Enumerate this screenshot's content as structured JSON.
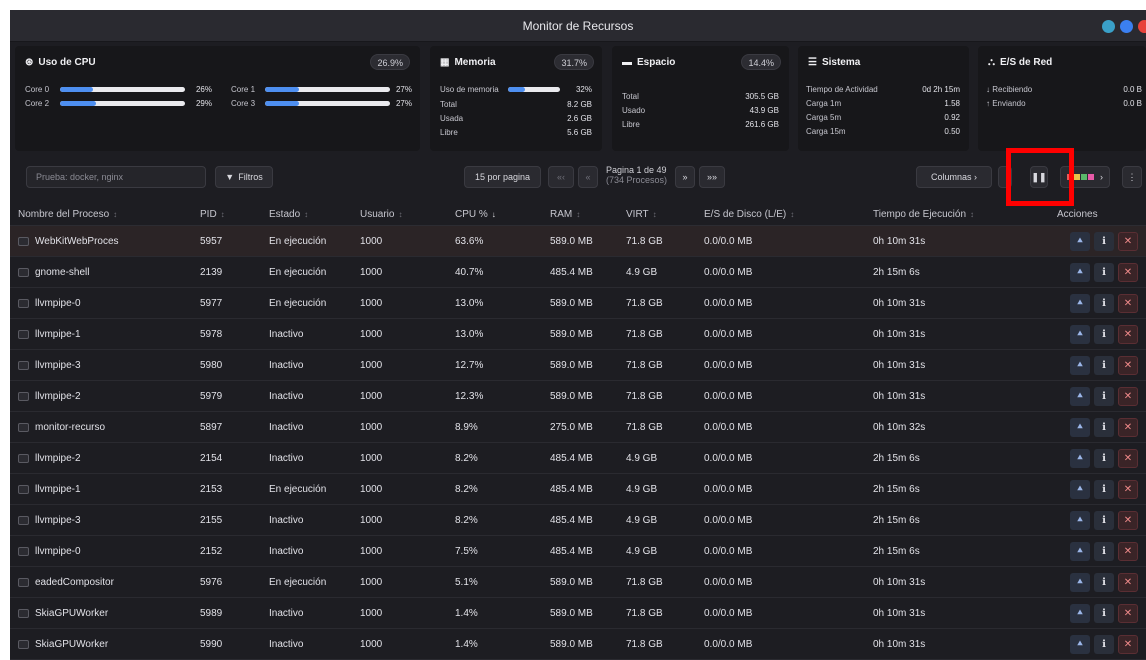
{
  "window": {
    "title": "Monitor de Recursos",
    "controls": [
      {
        "name": "window-minimize-button",
        "color": "#3aa0c8"
      },
      {
        "name": "window-maximize-button",
        "color": "#3b7ff0"
      },
      {
        "name": "window-close-button",
        "color": "#e8423b"
      }
    ]
  },
  "cpu": {
    "title": "Uso de CPU",
    "total": "26.9%",
    "cores": [
      {
        "label": "Core 0",
        "value": "26%",
        "fill": 0.26
      },
      {
        "label": "Core 1",
        "value": "27%",
        "fill": 0.27
      },
      {
        "label": "Core 2",
        "value": "29%",
        "fill": 0.29
      },
      {
        "label": "Core 3",
        "value": "27%",
        "fill": 0.27
      }
    ]
  },
  "memory": {
    "title": "Memoria",
    "percent": "31.7%",
    "usage_label": "Uso de memoria",
    "usage_value": "32%",
    "usage_fill": 0.32,
    "rows": [
      {
        "label": "Total",
        "value": "8.2 GB"
      },
      {
        "label": "Usada",
        "value": "2.6 GB"
      },
      {
        "label": "Libre",
        "value": "5.6 GB"
      }
    ]
  },
  "disk": {
    "title": "Espacio",
    "percent": "14.4%",
    "rows": [
      {
        "label": "Total",
        "value": "305.5 GB"
      },
      {
        "label": "Usado",
        "value": "43.9 GB"
      },
      {
        "label": "Libre",
        "value": "261.6 GB"
      }
    ]
  },
  "system": {
    "title": "Sistema",
    "rows": [
      {
        "label": "Tiempo de Actividad",
        "value": "0d 2h 15m"
      },
      {
        "label": "Carga 1m",
        "value": "1.58"
      },
      {
        "label": "Carga 5m",
        "value": "0.92"
      },
      {
        "label": "Carga 15m",
        "value": "0.50"
      }
    ]
  },
  "network": {
    "title": "E/S de Red",
    "rows": [
      {
        "label": "↓ Recibiendo",
        "value": "0.0 B"
      },
      {
        "label": "↑ Enviando",
        "value": "0.0 B"
      }
    ]
  },
  "toolbar": {
    "search_placeholder": "Prueba: docker, nginx",
    "filters_label": "Filtros",
    "per_page_label": "15 por pagina",
    "first_label": "«‹",
    "prev_label": "«",
    "page_label": "Pagina 1 de 49",
    "page_sub": "(734 Procesos)",
    "next_label": "»",
    "last_label": "»»",
    "columns_label": "Columnas ›",
    "colors_label": "›",
    "more_label": "⋮"
  },
  "table": {
    "headers": {
      "name": "Nombre del Proceso",
      "pid": "PID",
      "state": "Estado",
      "user": "Usuario",
      "cpu": "CPU %",
      "ram": "RAM",
      "virt": "VIRT",
      "disk": "E/S de Disco (L/E)",
      "time": "Tiempo de Ejecución",
      "actions": "Acciones"
    },
    "sort_glyph": "↕",
    "sort_active_glyph": "↓",
    "rows": [
      {
        "name": "WebKitWebProces",
        "pid": "5957",
        "state": "En ejecución",
        "user": "1000",
        "cpu": "63.6%",
        "ram": "589.0 MB",
        "virt": "71.8 GB",
        "disk": "0.0/0.0 MB",
        "time": "0h 10m 31s"
      },
      {
        "name": "gnome-shell",
        "pid": "2139",
        "state": "En ejecución",
        "user": "1000",
        "cpu": "40.7%",
        "ram": "485.4 MB",
        "virt": "4.9 GB",
        "disk": "0.0/0.0 MB",
        "time": "2h 15m 6s"
      },
      {
        "name": "llvmpipe-0",
        "pid": "5977",
        "state": "En ejecución",
        "user": "1000",
        "cpu": "13.0%",
        "ram": "589.0 MB",
        "virt": "71.8 GB",
        "disk": "0.0/0.0 MB",
        "time": "0h 10m 31s"
      },
      {
        "name": "llvmpipe-1",
        "pid": "5978",
        "state": "Inactivo",
        "user": "1000",
        "cpu": "13.0%",
        "ram": "589.0 MB",
        "virt": "71.8 GB",
        "disk": "0.0/0.0 MB",
        "time": "0h 10m 31s"
      },
      {
        "name": "llvmpipe-3",
        "pid": "5980",
        "state": "Inactivo",
        "user": "1000",
        "cpu": "12.7%",
        "ram": "589.0 MB",
        "virt": "71.8 GB",
        "disk": "0.0/0.0 MB",
        "time": "0h 10m 31s"
      },
      {
        "name": "llvmpipe-2",
        "pid": "5979",
        "state": "Inactivo",
        "user": "1000",
        "cpu": "12.3%",
        "ram": "589.0 MB",
        "virt": "71.8 GB",
        "disk": "0.0/0.0 MB",
        "time": "0h 10m 31s"
      },
      {
        "name": "monitor-recurso",
        "pid": "5897",
        "state": "Inactivo",
        "user": "1000",
        "cpu": "8.9%",
        "ram": "275.0 MB",
        "virt": "71.8 GB",
        "disk": "0.0/0.0 MB",
        "time": "0h 10m 32s"
      },
      {
        "name": "llvmpipe-2",
        "pid": "2154",
        "state": "Inactivo",
        "user": "1000",
        "cpu": "8.2%",
        "ram": "485.4 MB",
        "virt": "4.9 GB",
        "disk": "0.0/0.0 MB",
        "time": "2h 15m 6s"
      },
      {
        "name": "llvmpipe-1",
        "pid": "2153",
        "state": "En ejecución",
        "user": "1000",
        "cpu": "8.2%",
        "ram": "485.4 MB",
        "virt": "4.9 GB",
        "disk": "0.0/0.0 MB",
        "time": "2h 15m 6s"
      },
      {
        "name": "llvmpipe-3",
        "pid": "2155",
        "state": "Inactivo",
        "user": "1000",
        "cpu": "8.2%",
        "ram": "485.4 MB",
        "virt": "4.9 GB",
        "disk": "0.0/0.0 MB",
        "time": "2h 15m 6s"
      },
      {
        "name": "llvmpipe-0",
        "pid": "2152",
        "state": "Inactivo",
        "user": "1000",
        "cpu": "7.5%",
        "ram": "485.4 MB",
        "virt": "4.9 GB",
        "disk": "0.0/0.0 MB",
        "time": "2h 15m 6s"
      },
      {
        "name": "eadedCompositor",
        "pid": "5976",
        "state": "En ejecución",
        "user": "1000",
        "cpu": "5.1%",
        "ram": "589.0 MB",
        "virt": "71.8 GB",
        "disk": "0.0/0.0 MB",
        "time": "0h 10m 31s"
      },
      {
        "name": "SkiaGPUWorker",
        "pid": "5989",
        "state": "Inactivo",
        "user": "1000",
        "cpu": "1.4%",
        "ram": "589.0 MB",
        "virt": "71.8 GB",
        "disk": "0.0/0.0 MB",
        "time": "0h 10m 31s"
      },
      {
        "name": "SkiaGPUWorker",
        "pid": "5990",
        "state": "Inactivo",
        "user": "1000",
        "cpu": "1.4%",
        "ram": "589.0 MB",
        "virt": "71.8 GB",
        "disk": "0.0/0.0 MB",
        "time": "0h 10m 31s"
      }
    ]
  },
  "colors": {
    "accent": "#4e8ff0",
    "highlight": "#ff0000",
    "selected_row": "#2b2426"
  }
}
